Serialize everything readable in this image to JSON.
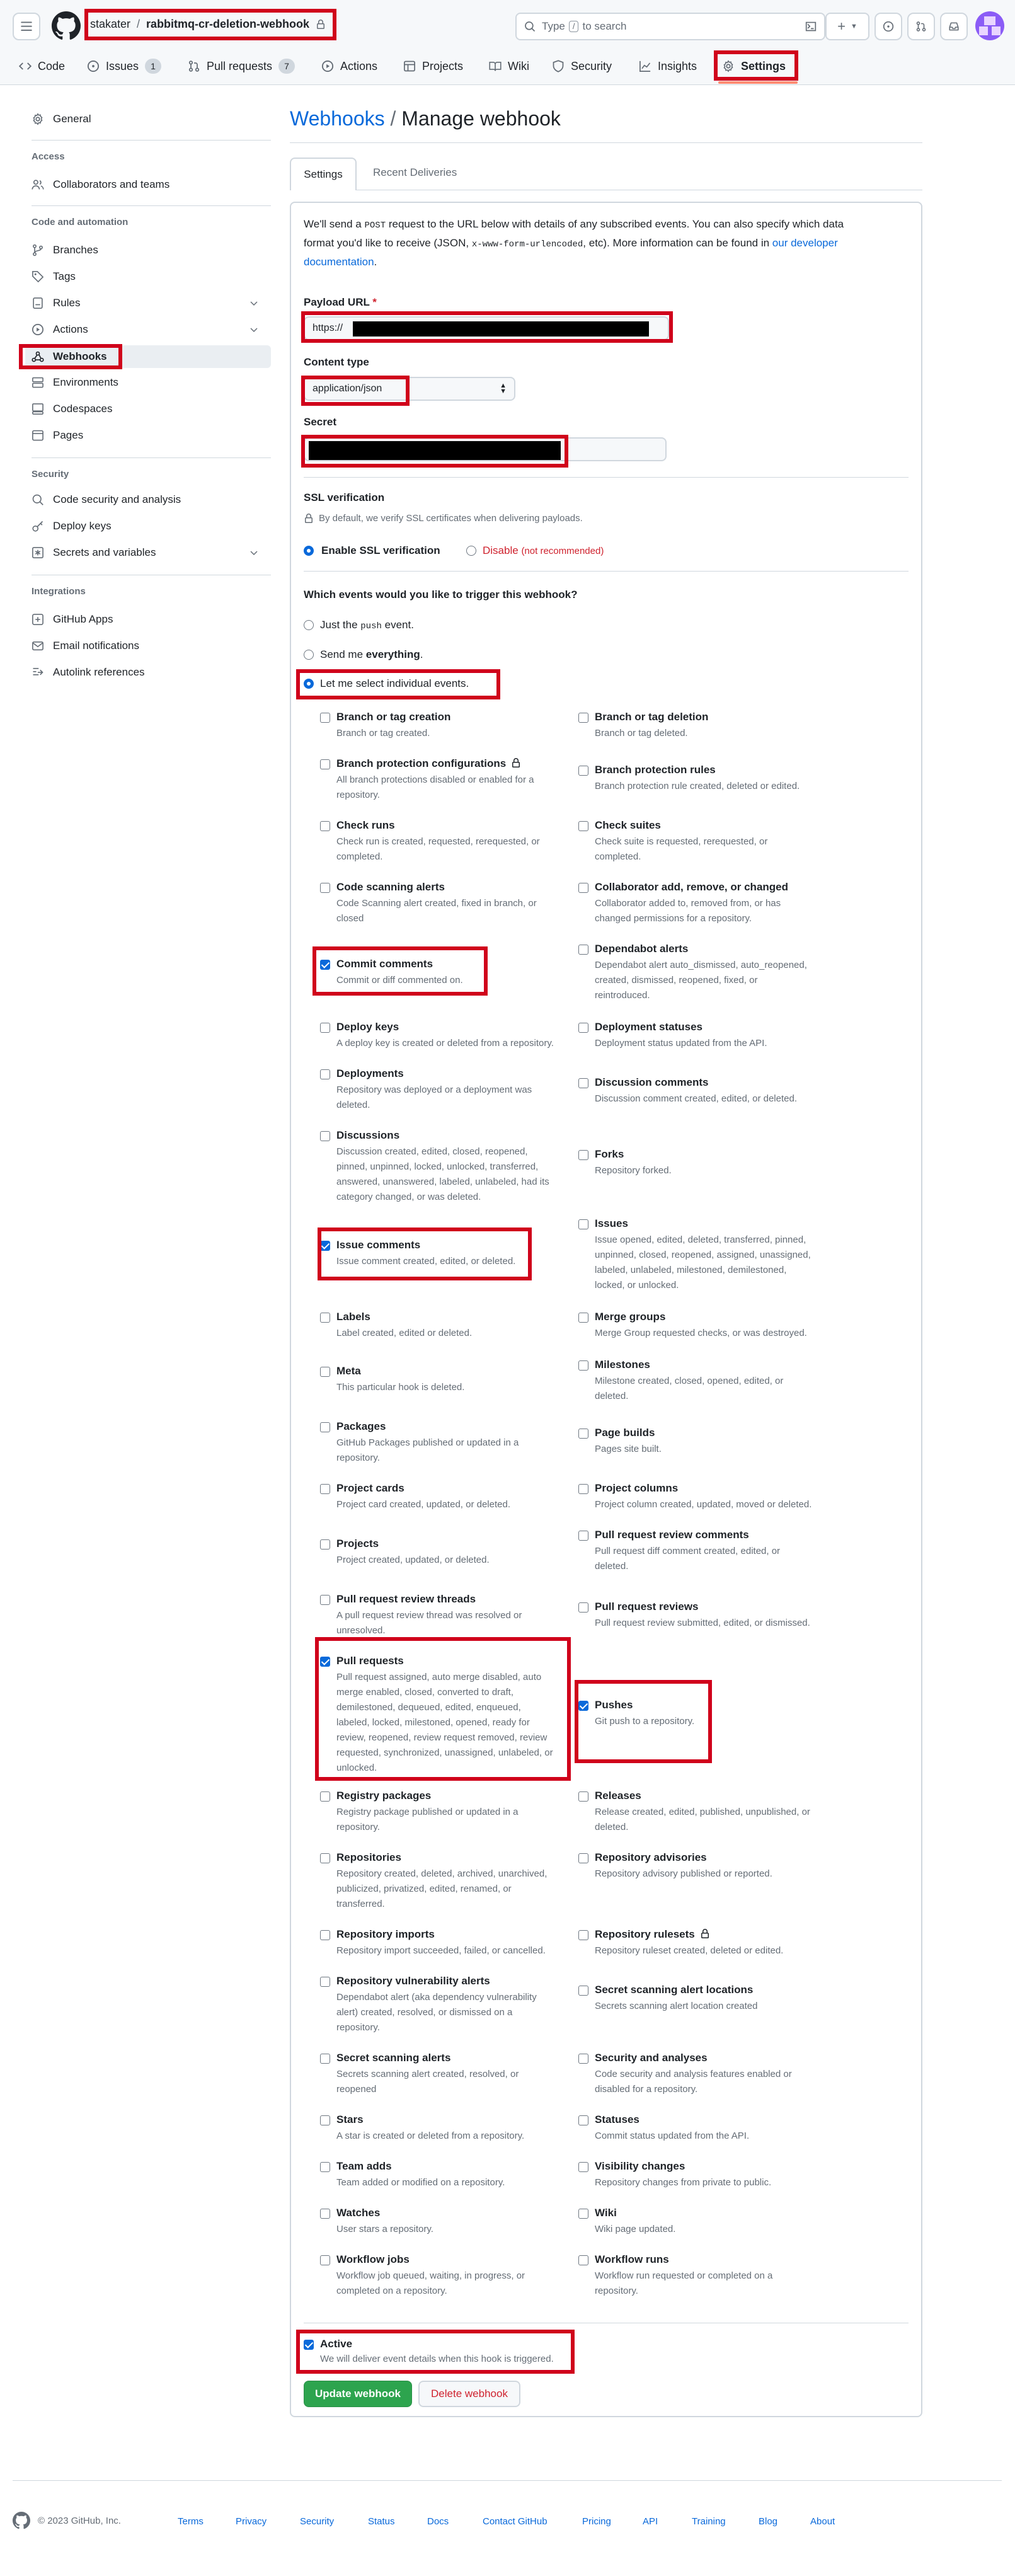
{
  "header": {
    "owner": "stakater",
    "separator": "/",
    "repo": "rabbitmq-cr-deletion-webhook",
    "search_placeholder_pre": "Type",
    "search_key": "/",
    "search_placeholder_post": "to search",
    "plus_label": "+"
  },
  "nav": {
    "tabs": [
      {
        "label": "Code"
      },
      {
        "label": "Issues",
        "count": "1"
      },
      {
        "label": "Pull requests",
        "count": "7"
      },
      {
        "label": "Actions"
      },
      {
        "label": "Projects"
      },
      {
        "label": "Wiki"
      },
      {
        "label": "Security"
      },
      {
        "label": "Insights"
      },
      {
        "label": "Settings"
      }
    ]
  },
  "sidebar": {
    "general": "General",
    "access_head": "Access",
    "collaborators": "Collaborators and teams",
    "code_head": "Code and automation",
    "branches": "Branches",
    "tags": "Tags",
    "rules": "Rules",
    "actions": "Actions",
    "webhooks": "Webhooks",
    "environments": "Environments",
    "codespaces": "Codespaces",
    "pages": "Pages",
    "security_head": "Security",
    "code_security": "Code security and analysis",
    "deploy_keys": "Deploy keys",
    "secrets": "Secrets and variables",
    "integrations_head": "Integrations",
    "github_apps": "GitHub Apps",
    "email_notifications": "Email notifications",
    "autolink": "Autolink references"
  },
  "main": {
    "breadcrumb_link": "Webhooks",
    "breadcrumb_sep": "/",
    "breadcrumb_current": "Manage webhook",
    "tab_settings": "Settings",
    "tab_deliveries": "Recent Deliveries",
    "intro_1": "We'll send a",
    "intro_post": "POST",
    "intro_2": "request to the URL below with details of any subscribed events. You can also specify which data",
    "intro_3": "format you'd like to receive (JSON,",
    "intro_code": "x-www-form-urlencoded",
    "intro_4": ", etc). More information can be found in",
    "intro_link1": "our developer",
    "intro_link2": "documentation",
    "intro_end": ".",
    "payload_label": "Payload URL",
    "required_mark": "*",
    "payload_value": "https://",
    "content_type_label": "Content type",
    "content_type_value": "application/json",
    "secret_label": "Secret",
    "ssl_label": "SSL verification",
    "ssl_note": "By default, we verify SSL certificates when delivering payloads.",
    "ssl_enable": "Enable SSL verification",
    "ssl_disable": "Disable",
    "ssl_disable_note": "(not recommended)",
    "events_question": "Which events would you like to trigger this webhook?",
    "opt_push_pre": "Just the",
    "opt_push_code": "push",
    "opt_push_post": "event.",
    "opt_everything_pre": "Send me",
    "opt_everything_bold": "everything",
    "opt_everything_post": ".",
    "opt_select": "Let me select individual events.",
    "active_label": "Active",
    "active_desc": "We will deliver event details when this hook is triggered.",
    "update_button": "Update webhook",
    "delete_button": "Delete webhook"
  },
  "events_left": [
    {
      "title": "Branch or tag creation",
      "desc": [
        "Branch or tag created."
      ],
      "checked": false
    },
    {
      "title": "Branch protection configurations",
      "desc": [
        "All branch protections disabled or enabled for a",
        "repository."
      ],
      "checked": false,
      "lock": true
    },
    {
      "title": "Check runs",
      "desc": [
        "Check run is created, requested, rerequested, or",
        "completed."
      ],
      "checked": false
    },
    {
      "title": "Code scanning alerts",
      "desc": [
        "Code Scanning alert created, fixed in branch, or",
        "closed"
      ],
      "checked": false
    },
    {
      "title": "Commit comments",
      "desc": [
        "Commit or diff commented on."
      ],
      "checked": true
    },
    {
      "title": "Deploy keys",
      "desc": [
        "A deploy key is created or deleted from a repository."
      ],
      "checked": false
    },
    {
      "title": "Deployments",
      "desc": [
        "Repository was deployed or a deployment was",
        "deleted."
      ],
      "checked": false
    },
    {
      "title": "Discussions",
      "desc": [
        "Discussion created, edited, closed, reopened,",
        "pinned, unpinned, locked, unlocked, transferred,",
        "answered, unanswered, labeled, unlabeled, had its",
        "category changed, or was deleted."
      ],
      "checked": false
    },
    {
      "title": "Issue comments",
      "desc": [
        "Issue comment created, edited, or deleted."
      ],
      "checked": true
    },
    {
      "title": "Labels",
      "desc": [
        "Label created, edited or deleted."
      ],
      "checked": false
    },
    {
      "title": "Meta",
      "desc": [
        "This particular hook is deleted."
      ],
      "checked": false
    },
    {
      "title": "Packages",
      "desc": [
        "GitHub Packages published or updated in a",
        "repository."
      ],
      "checked": false
    },
    {
      "title": "Project cards",
      "desc": [
        "Project card created, updated, or deleted."
      ],
      "checked": false
    },
    {
      "title": "Projects",
      "desc": [
        "Project created, updated, or deleted."
      ],
      "checked": false
    },
    {
      "title": "Pull request review threads",
      "desc": [
        "A pull request review thread was resolved or",
        "unresolved."
      ],
      "checked": false
    },
    {
      "title": "Pull requests",
      "desc": [
        "Pull request assigned, auto merge disabled, auto",
        "merge enabled, closed, converted to draft,",
        "demilestoned, dequeued, edited, enqueued,",
        "labeled, locked, milestoned, opened, ready for",
        "review, reopened, review request removed, review",
        "requested, synchronized, unassigned, unlabeled, or",
        "unlocked."
      ],
      "checked": true
    },
    {
      "title": "Registry packages",
      "desc": [
        "Registry package published or updated in a",
        "repository."
      ],
      "checked": false
    },
    {
      "title": "Repositories",
      "desc": [
        "Repository created, deleted, archived, unarchived,",
        "publicized, privatized, edited, renamed, or",
        "transferred."
      ],
      "checked": false
    },
    {
      "title": "Repository imports",
      "desc": [
        "Repository import succeeded, failed, or cancelled."
      ],
      "checked": false
    },
    {
      "title": "Repository vulnerability alerts",
      "desc": [
        "Dependabot alert (aka dependency vulnerability",
        "alert) created, resolved, or dismissed on a",
        "repository."
      ],
      "checked": false
    },
    {
      "title": "Secret scanning alerts",
      "desc": [
        "Secrets scanning alert created, resolved, or",
        "reopened"
      ],
      "checked": false
    },
    {
      "title": "Stars",
      "desc": [
        "A star is created or deleted from a repository."
      ],
      "checked": false
    },
    {
      "title": "Team adds",
      "desc": [
        "Team added or modified on a repository."
      ],
      "checked": false
    },
    {
      "title": "Watches",
      "desc": [
        "User stars a repository."
      ],
      "checked": false
    },
    {
      "title": "Workflow jobs",
      "desc": [
        "Workflow job queued, waiting, in progress, or",
        "completed on a repository."
      ],
      "checked": false
    }
  ],
  "events_right": [
    {
      "title": "Branch or tag deletion",
      "desc": [
        "Branch or tag deleted."
      ],
      "checked": false
    },
    {
      "title": "Branch protection rules",
      "desc": [
        "Branch protection rule created, deleted or edited."
      ],
      "checked": false
    },
    {
      "title": "Check suites",
      "desc": [
        "Check suite is requested, rerequested, or",
        "completed."
      ],
      "checked": false
    },
    {
      "title": "Collaborator add, remove, or changed",
      "desc": [
        "Collaborator added to, removed from, or has",
        "changed permissions for a repository."
      ],
      "checked": false
    },
    {
      "title": "Dependabot alerts",
      "desc": [
        "Dependabot alert auto_dismissed, auto_reopened,",
        "created, dismissed, reopened, fixed, or",
        "reintroduced."
      ],
      "checked": false
    },
    {
      "title": "Deployment statuses",
      "desc": [
        "Deployment status updated from the API."
      ],
      "checked": false
    },
    {
      "title": "Discussion comments",
      "desc": [
        "Discussion comment created, edited, or deleted."
      ],
      "checked": false
    },
    {
      "title": "Forks",
      "desc": [
        "Repository forked."
      ],
      "checked": false
    },
    {
      "title": "Issues",
      "desc": [
        "Issue opened, edited, deleted, transferred, pinned,",
        "unpinned, closed, reopened, assigned, unassigned,",
        "labeled, unlabeled, milestoned, demilestoned,",
        "locked, or unlocked."
      ],
      "checked": false
    },
    {
      "title": "Merge groups",
      "desc": [
        "Merge Group requested checks, or was destroyed."
      ],
      "checked": false
    },
    {
      "title": "Milestones",
      "desc": [
        "Milestone created, closed, opened, edited, or",
        "deleted."
      ],
      "checked": false
    },
    {
      "title": "Page builds",
      "desc": [
        "Pages site built."
      ],
      "checked": false
    },
    {
      "title": "Project columns",
      "desc": [
        "Project column created, updated, moved or deleted."
      ],
      "checked": false
    },
    {
      "title": "Pull request review comments",
      "desc": [
        "Pull request diff comment created, edited, or",
        "deleted."
      ],
      "checked": false
    },
    {
      "title": "Pull request reviews",
      "desc": [
        "Pull request review submitted, edited, or dismissed."
      ],
      "checked": false
    },
    {
      "title": "Pushes",
      "desc": [
        "Git push to a repository."
      ],
      "checked": true
    },
    {
      "title": "Releases",
      "desc": [
        "Release created, edited, published, unpublished, or",
        "deleted."
      ],
      "checked": false
    },
    {
      "title": "Repository advisories",
      "desc": [
        "Repository advisory published or reported."
      ],
      "checked": false
    },
    {
      "title": "Repository rulesets",
      "desc": [
        "Repository ruleset created, deleted or edited."
      ],
      "checked": false,
      "lock": true
    },
    {
      "title": "Secret scanning alert locations",
      "desc": [
        "Secrets scanning alert location created"
      ],
      "checked": false
    },
    {
      "title": "Security and analyses",
      "desc": [
        "Code security and analysis features enabled or",
        "disabled for a repository."
      ],
      "checked": false
    },
    {
      "title": "Statuses",
      "desc": [
        "Commit status updated from the API."
      ],
      "checked": false
    },
    {
      "title": "Visibility changes",
      "desc": [
        "Repository changes from private to public."
      ],
      "checked": false
    },
    {
      "title": "Wiki",
      "desc": [
        "Wiki page updated."
      ],
      "checked": false
    },
    {
      "title": "Workflow runs",
      "desc": [
        "Workflow run requested or completed on a",
        "repository."
      ],
      "checked": false
    }
  ],
  "footer": {
    "copyright": "© 2023 GitHub, Inc.",
    "links": [
      "Terms",
      "Privacy",
      "Security",
      "Status",
      "Docs",
      "Contact GitHub",
      "Pricing",
      "API",
      "Training",
      "Blog",
      "About"
    ]
  },
  "colors": {
    "accent": "#0969da",
    "highlight": "#d0021b",
    "primary_button": "#2da44e",
    "danger": "#cf222e"
  }
}
